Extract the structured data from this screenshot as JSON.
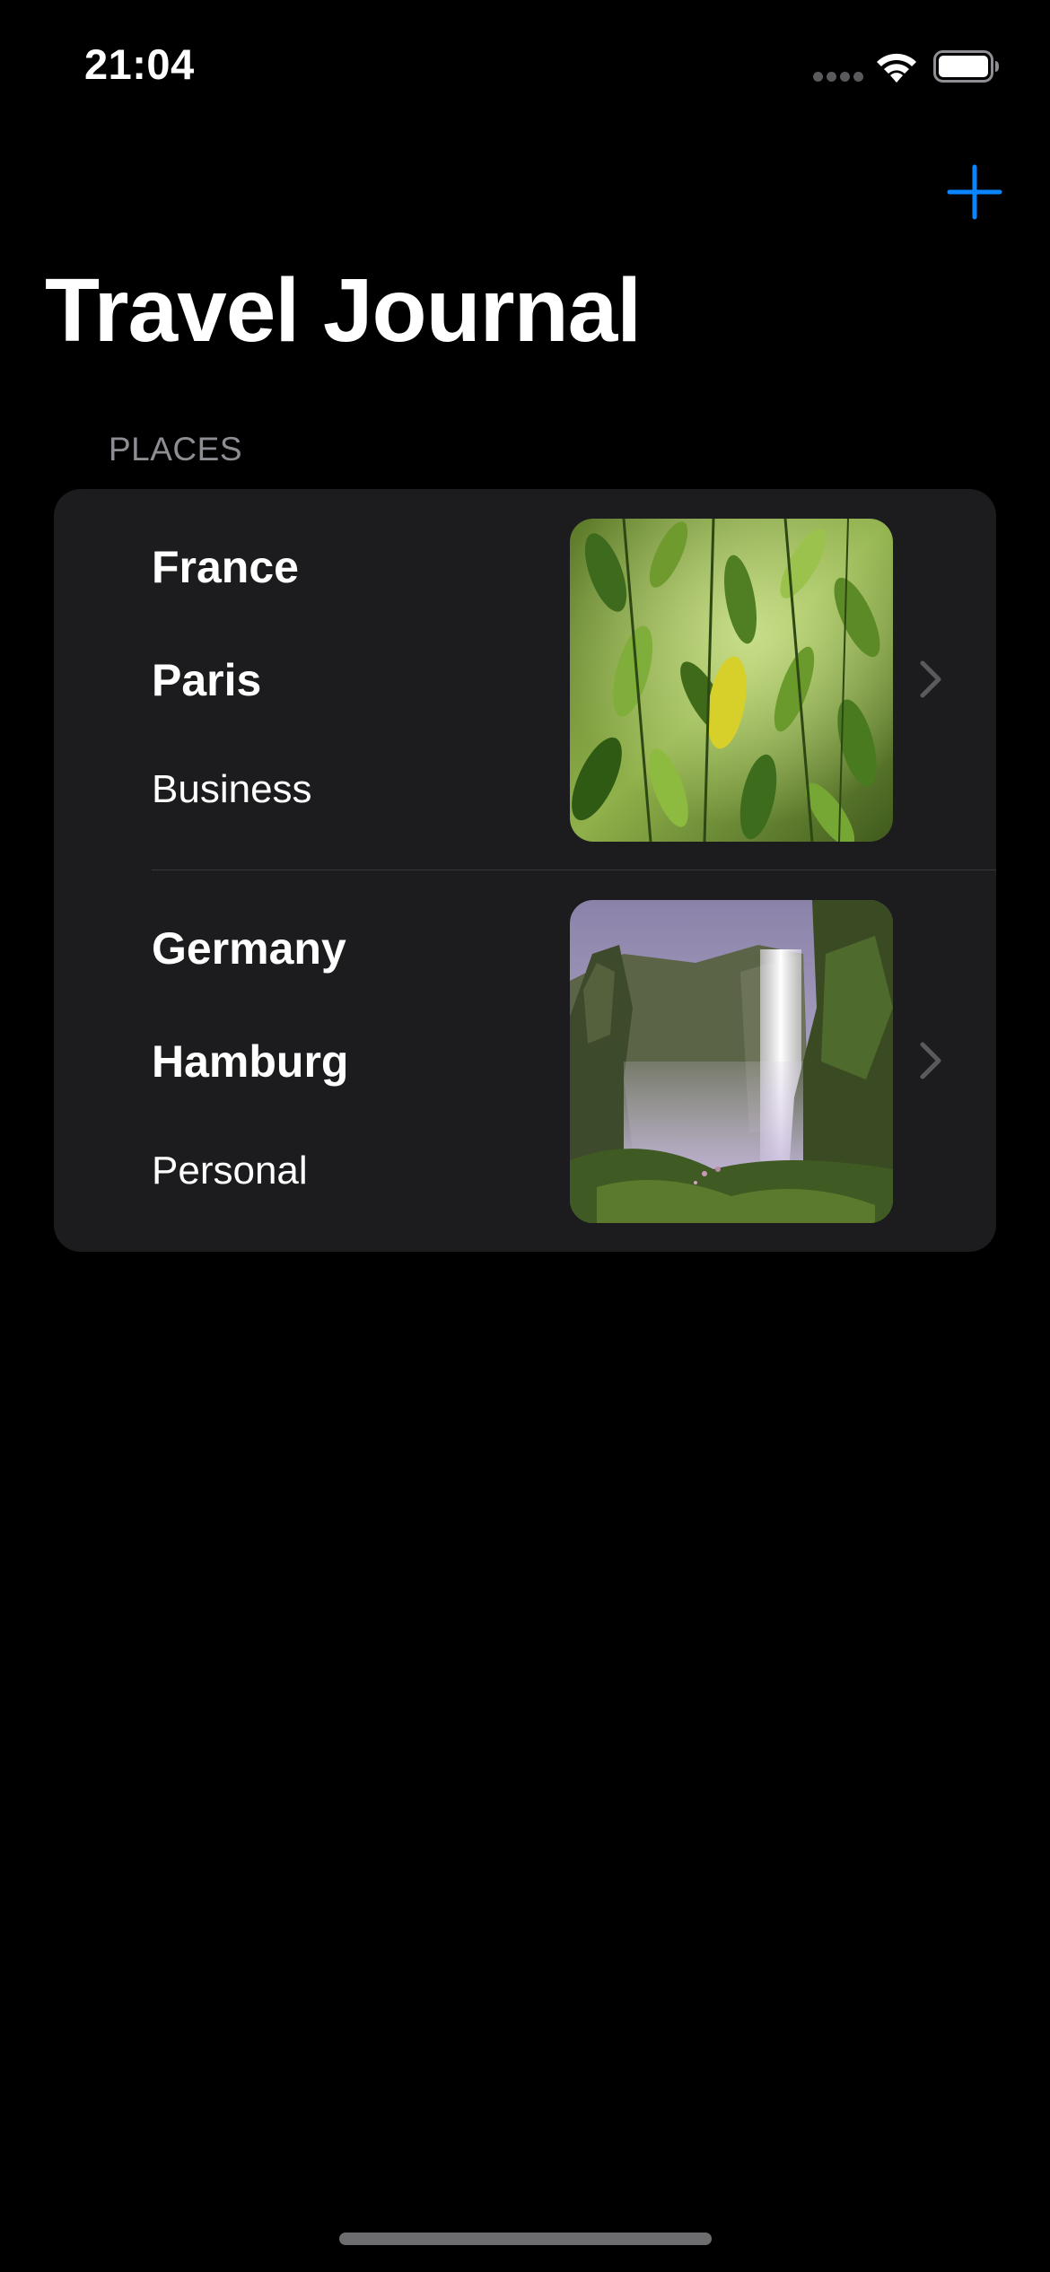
{
  "status_bar": {
    "time": "21:04",
    "icons": [
      "signal-dots-icon",
      "wifi-icon",
      "battery-icon"
    ]
  },
  "nav": {
    "add_icon": "plus-icon",
    "title": "Travel Journal"
  },
  "section": {
    "header": "PLACES"
  },
  "places": [
    {
      "country": "France",
      "city": "Paris",
      "type": "Business",
      "image": "leaves-photo"
    },
    {
      "country": "Germany",
      "city": "Hamburg",
      "type": "Personal",
      "image": "waterfall-photo"
    }
  ],
  "colors": {
    "background": "#000000",
    "card": "#1c1c1e",
    "accent": "#0a84ff",
    "secondary_text": "#8d8d93",
    "separator": "#38383a"
  }
}
